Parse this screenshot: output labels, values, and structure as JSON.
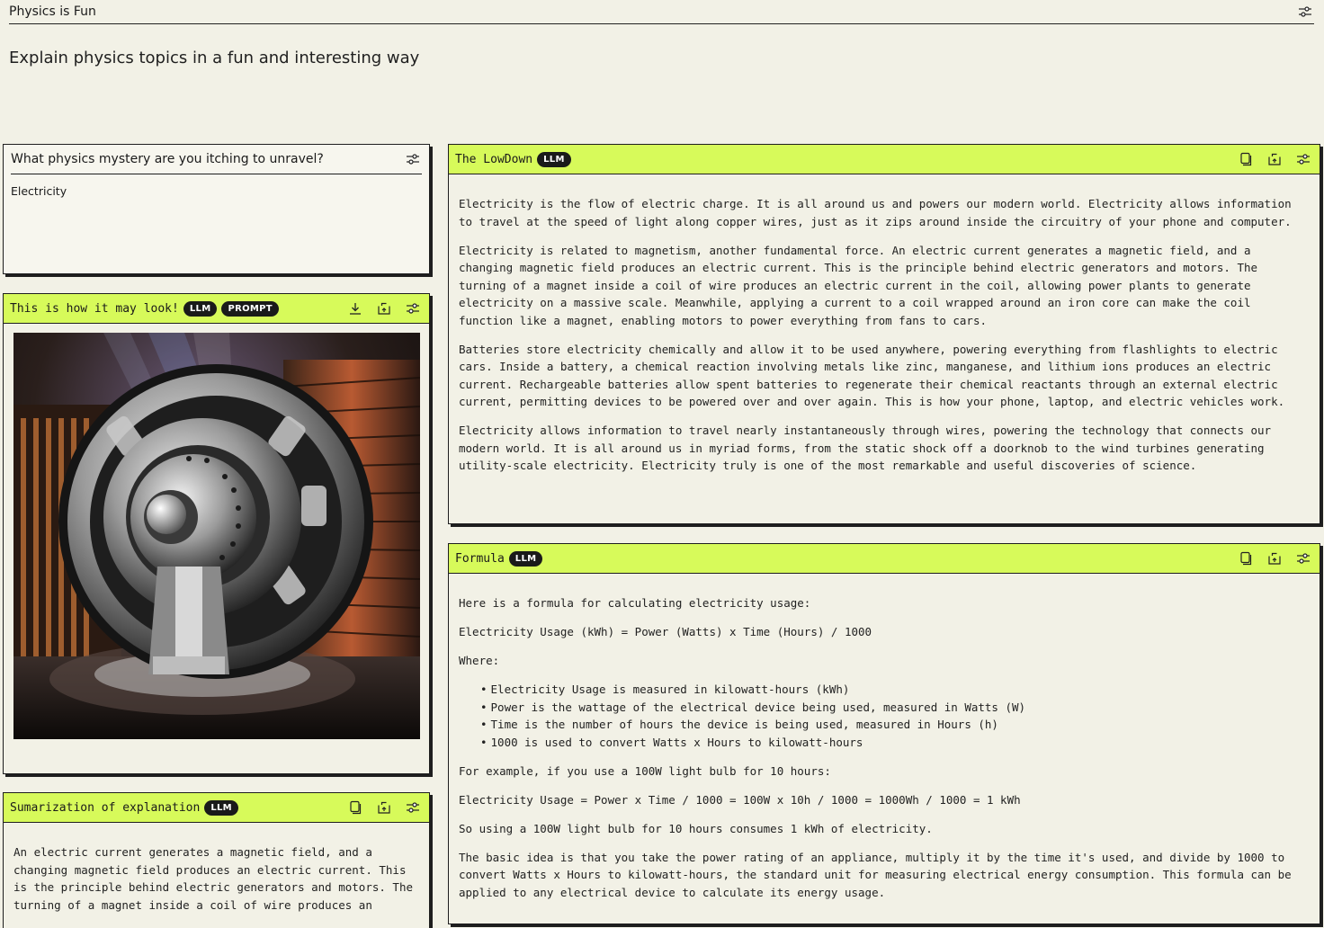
{
  "app": {
    "title": "Physics is Fun",
    "subtitle": "Explain physics topics in a fun and interesting way"
  },
  "input_panel": {
    "title": "What physics mystery are you itching to unravel?",
    "value": "Electricity"
  },
  "image_panel": {
    "title": "This is how it may look!",
    "badges": [
      "LLM",
      "PROMPT"
    ]
  },
  "summary_panel": {
    "title": "Sumarization of explanation",
    "badge": "LLM",
    "text": "An electric current generates a magnetic field, and a changing magnetic field produces an electric current. This is the principle behind electric generators and motors. The turning of a magnet inside a coil of wire produces an"
  },
  "lowdown_panel": {
    "title": "The LowDown",
    "badge": "LLM",
    "paragraphs": [
      "Electricity is the flow of electric charge. It is all around us and powers our modern world. Electricity allows information to travel at the speed of light along copper wires, just as it zips around inside the circuitry of your phone and computer.",
      "Electricity is related to magnetism, another fundamental force. An electric current generates a magnetic field, and a changing magnetic field produces an electric current. This is the principle behind electric generators and motors. The turning of a magnet inside a coil of wire produces an electric current in the coil, allowing power plants to generate electricity on a massive scale. Meanwhile, applying a current to a coil wrapped around an iron core can make the coil function like a magnet, enabling motors to power everything from fans to cars.",
      "Batteries store electricity chemically and allow it to be used anywhere, powering everything from flashlights to electric cars. Inside a battery, a chemical reaction involving metals like zinc, manganese, and lithium ions produces an electric current. Rechargeable batteries allow spent batteries to regenerate their chemical reactants through an external electric current, permitting devices to be powered over and over again. This is how your phone, laptop, and electric vehicles work.",
      "Electricity allows information to travel nearly instantaneously through wires, powering the technology that connects our modern world. It is all around us in myriad forms, from the static shock off a doorknob to the wind turbines generating utility-scale electricity. Electricity truly is one of the most remarkable and useful discoveries of science."
    ]
  },
  "formula_panel": {
    "title": "Formula",
    "badge": "LLM",
    "intro": "Here is a formula for calculating electricity usage:",
    "formula": "Electricity Usage (kWh) = Power (Watts) x Time (Hours) / 1000",
    "where": "Where:",
    "bullets": [
      "Electricity Usage is measured in kilowatt-hours (kWh)",
      "Power is the wattage of the electrical device being used, measured in Watts (W)",
      "Time is the number of hours the device is being used, measured in Hours (h)",
      "1000 is used to convert Watts x Hours to kilowatt-hours"
    ],
    "example_intro": "For example, if you use a 100W light bulb for 10 hours:",
    "example_calc": "Electricity Usage = Power x Time / 1000 = 100W x 10h / 1000 = 1000Wh / 1000 = 1 kWh",
    "example_result": "So using a 100W light bulb for 10 hours consumes 1 kWh of electricity.",
    "closing": "The basic idea is that you take the power rating of an appliance, multiply it by the time it's used, and divide by 1000 to convert Watts x Hours to kilowatt-hours, the standard unit for measuring electrical energy consumption. This formula can be applied to any electrical device to calculate its energy usage."
  },
  "icons": {
    "settings": "sliders-icon",
    "copy": "copy-icon",
    "share": "share-icon",
    "download": "download-icon"
  },
  "colors": {
    "panel_header": "#d7fa5a",
    "background": "#f2f1e6",
    "badge": "#1a1a1a"
  }
}
